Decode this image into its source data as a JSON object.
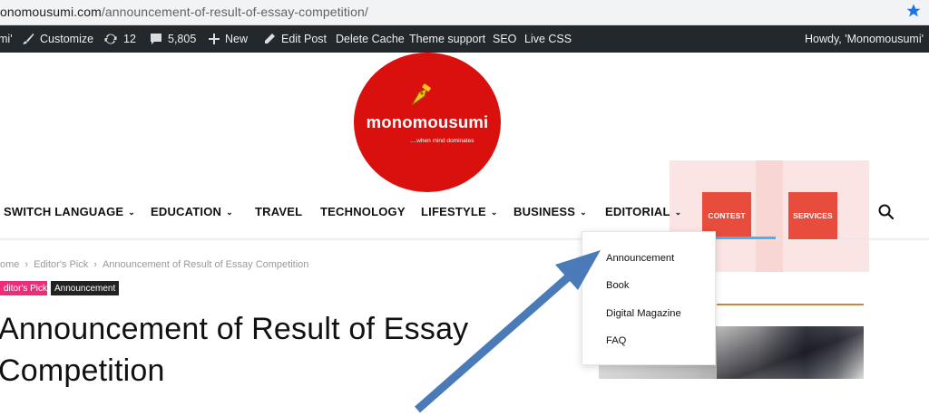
{
  "browser": {
    "url_host": "onomousumi.com",
    "url_path": "/announcement-of-result-of-essay-competition/"
  },
  "adminbar": {
    "site_fragment": "mi'",
    "customize": "Customize",
    "updates_count": "12",
    "comments_count": "5,805",
    "new": "New",
    "edit_post": "Edit Post",
    "delete_cache": "Delete Cache",
    "theme_support": "Theme support",
    "seo": "SEO",
    "live_css": "Live CSS",
    "howdy": "Howdy, 'Monomousumi'"
  },
  "logo": {
    "name": "monomousumi",
    "tagline": "....when mind dominates"
  },
  "nav": {
    "items": [
      {
        "label": "SWITCH LANGUAGE",
        "has_children": true
      },
      {
        "label": "EDUCATION",
        "has_children": true
      },
      {
        "label": "TRAVEL",
        "has_children": false
      },
      {
        "label": "TECHNOLOGY",
        "has_children": false
      },
      {
        "label": "LIFESTYLE",
        "has_children": true
      },
      {
        "label": "BUSINESS",
        "has_children": true
      },
      {
        "label": "EDITORIAL",
        "has_children": true
      }
    ],
    "chevron": "⌄",
    "contest": "CONTEST",
    "services": "SERVICES"
  },
  "dropdown": {
    "items": [
      "Announcement",
      "Book",
      "Digital Magazine",
      "FAQ"
    ]
  },
  "breadcrumb": {
    "home": "ome",
    "editors_pick": "Editor's Pick",
    "current": "Announcement of Result of Essay Competition",
    "sep": "›"
  },
  "tags": {
    "editors_pick": "ditor's Pick",
    "announcement": "Announcement"
  },
  "post": {
    "title_line1": "Announcement of Result of Essay",
    "title_line2": "Competition"
  },
  "colors": {
    "accent_blue": "#4db2ec",
    "logo_red": "#d9100d",
    "button_red": "#e74c3c",
    "tag_pink": "#ec2d7b",
    "arrow_blue": "#4a7ab8"
  }
}
